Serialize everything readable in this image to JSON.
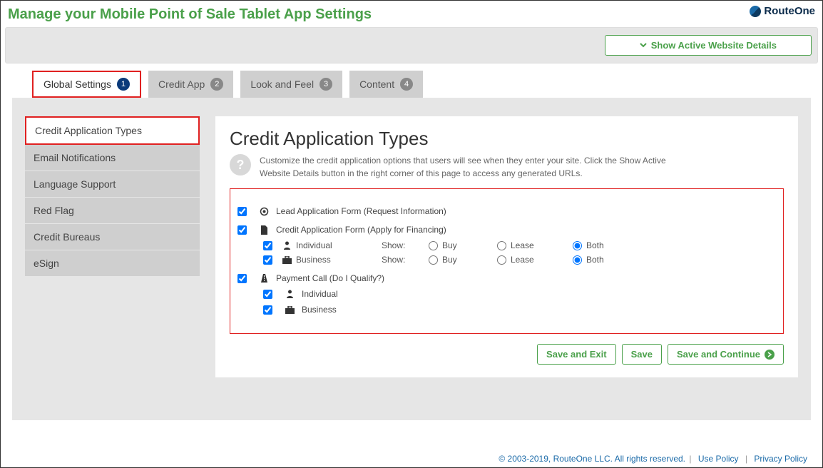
{
  "header": {
    "title": "Manage your Mobile Point of Sale Tablet App Settings",
    "brand": "RouteOne",
    "show_details_btn": "Show Active Website Details"
  },
  "tabs": [
    {
      "label": "Global Settings",
      "num": "1"
    },
    {
      "label": "Credit App",
      "num": "2"
    },
    {
      "label": "Look and Feel",
      "num": "3"
    },
    {
      "label": "Content",
      "num": "4"
    }
  ],
  "sidebar": {
    "items": [
      {
        "label": "Credit Application Types"
      },
      {
        "label": "Email Notifications"
      },
      {
        "label": "Language Support"
      },
      {
        "label": "Red Flag"
      },
      {
        "label": "Credit Bureaus"
      },
      {
        "label": "eSign"
      }
    ]
  },
  "main": {
    "title": "Credit Application Types",
    "description": "Customize the credit application options that users will see when they enter your site. Click the Show Active Website Details button in the right corner of this page to access any generated URLs.",
    "form": {
      "lead_label": "Lead Application Form (Request Information)",
      "credit_label": "Credit Application Form (Apply for Financing)",
      "show_label": "Show:",
      "individual": "Individual",
      "business": "Business",
      "buy": "Buy",
      "lease": "Lease",
      "both": "Both",
      "payment_call": "Payment Call (Do I Qualify?)"
    },
    "actions": {
      "save_exit": "Save and Exit",
      "save": "Save",
      "save_continue": "Save and Continue"
    }
  },
  "footer": {
    "copyright": "© 2003-2019, RouteOne LLC. All rights reserved.",
    "use_policy": "Use Policy",
    "privacy_policy": "Privacy Policy"
  }
}
